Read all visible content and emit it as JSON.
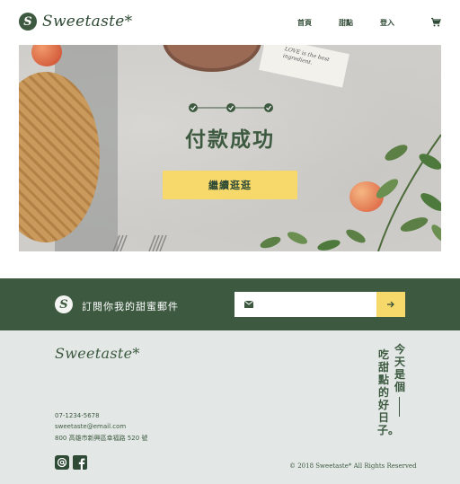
{
  "header": {
    "brand": "Sweetaste*",
    "logo_mark": "S",
    "nav": {
      "home": "首頁",
      "desserts": "甜點",
      "login": "登入"
    },
    "cart_icon": "shopping-cart-icon"
  },
  "hero": {
    "steps": {
      "total": 3,
      "completed": 3
    },
    "title": "付款成功",
    "continue_label": "繼續逛逛",
    "paper_text": "LOVE is the best ingredient."
  },
  "subscribe": {
    "label": "訂閱你我的甜蜜郵件",
    "email_value": "",
    "mail_icon": "mail-icon",
    "submit_icon": "arrow-right-icon"
  },
  "footer": {
    "brand": "Sweetaste*",
    "phone": "07-1234-5678",
    "email": "sweetaste@email.com",
    "address": "800 高雄市新興區幸福路 520 號",
    "social": [
      "at-icon",
      "facebook-icon"
    ],
    "copyright": "© 2018 Sweetaste* All Rights Reserved",
    "slogan_line1": "今天是個",
    "slogan_line2": "吃甜點的好日子。"
  },
  "colors": {
    "primary_green": "#3d5a40",
    "accent_yellow": "#f7d96b",
    "footer_bg": "#e3e8e6"
  }
}
